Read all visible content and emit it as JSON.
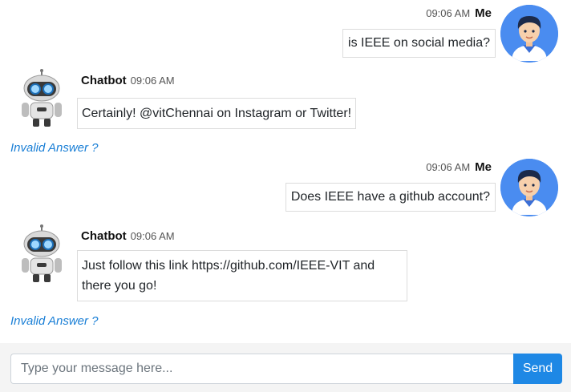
{
  "messages": [
    {
      "sender": "Me",
      "time": "09:06 AM",
      "text": "is IEEE on social media?"
    },
    {
      "sender": "Chatbot",
      "time": "09:06 AM",
      "text": "Certainly! @vitChennai on Instagram or Twitter!",
      "feedback": "Invalid Answer ?"
    },
    {
      "sender": "Me",
      "time": "09:06 AM",
      "text": "Does IEEE have a github account?"
    },
    {
      "sender": "Chatbot",
      "time": "09:06 AM",
      "text_line1": "Just follow this link https://github.com/IEEE-VIT and",
      "text_line2": "there you go!",
      "feedback": "Invalid Answer ?"
    }
  ],
  "input": {
    "placeholder": "Type your message here...",
    "value": ""
  },
  "send_label": "Send",
  "icons": {
    "user_avatar": "user-avatar-icon",
    "bot_avatar": "robot-avatar-icon"
  },
  "colors": {
    "accent": "#1e88e5",
    "link": "#1a7fd6",
    "avatar_bg": "#4a8cf0"
  }
}
